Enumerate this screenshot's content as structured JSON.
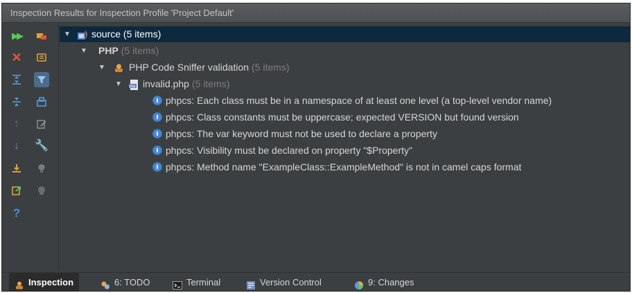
{
  "window": {
    "title": "Inspection Results for Inspection Profile 'Project Default'"
  },
  "toolbar": {
    "left": [
      "run-icon",
      "close-icon",
      "expand-all-icon",
      "collapse-all-icon",
      "previous-icon",
      "next-icon",
      "export-icon",
      "import-icon",
      "help-icon"
    ],
    "right": [
      "group-by-severity-icon",
      "group-by-directory-icon",
      "filter-icon",
      "module-icon",
      "edit-settings-icon",
      "wrench-icon",
      "bulb-icon",
      "suppress-icon"
    ]
  },
  "tree": {
    "source": {
      "name": "source",
      "count": "(5 items)"
    },
    "php": {
      "name": "PHP",
      "count": "(5 items)"
    },
    "sniffer": {
      "name": "PHP Code Sniffer validation",
      "count": "(5 items)"
    },
    "file": {
      "name": "invalid.php",
      "count": "(5 items)"
    },
    "issues": [
      "phpcs: Each class must be in a namespace of at least one level (a top-level vendor name)",
      "phpcs: Class constants must be uppercase; expected VERSION but found version",
      "phpcs: The var keyword must not be used to declare a property",
      "phpcs: Visibility must be declared on property \"$Property\"",
      "phpcs: Method name \"ExampleClass::ExampleMethod\" is not in camel caps format"
    ]
  },
  "statusbar": {
    "tabs": [
      {
        "label": "Inspection",
        "icon": "inspection-icon"
      },
      {
        "label": "6: TODO",
        "icon": "todo-icon"
      },
      {
        "label": "Terminal",
        "icon": "terminal-icon"
      },
      {
        "label": "Version Control",
        "icon": "version-control-icon"
      },
      {
        "label": "9: Changes",
        "icon": "changes-icon"
      }
    ]
  },
  "colors": {
    "background": "#3c3f41",
    "selection": "#0d293e",
    "text": "#d5d5d5",
    "dim": "#7d7d7d",
    "accent": "#4a88d0"
  }
}
